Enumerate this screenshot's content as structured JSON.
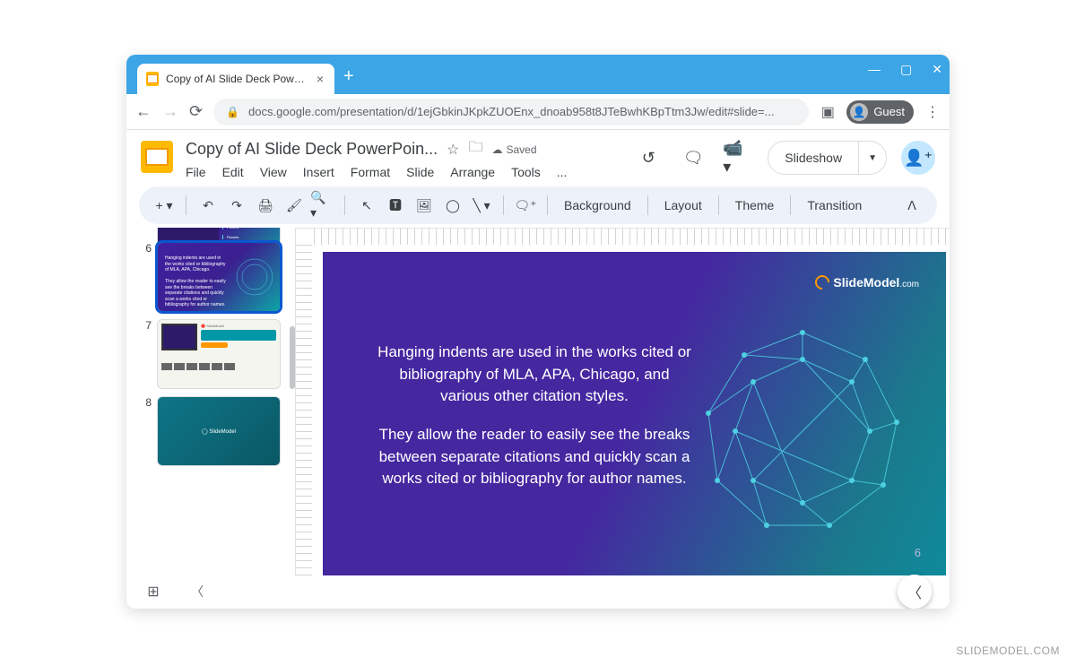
{
  "browser": {
    "tab_title": "Copy of AI Slide Deck PowerPoin",
    "url": "docs.google.com/presentation/d/1ejGbkinJKpkZUOEnx_dnoab958t8JTeBwhKBpTtm3Jw/edit#slide=...",
    "guest_label": "Guest"
  },
  "doc": {
    "title": "Copy of AI Slide Deck PowerPoin...",
    "saved": "Saved"
  },
  "menu": {
    "file": "File",
    "edit": "Edit",
    "view": "View",
    "insert": "Insert",
    "format": "Format",
    "slide": "Slide",
    "arrange": "Arrange",
    "tools": "Tools",
    "more": "..."
  },
  "header_btns": {
    "slideshow": "Slideshow"
  },
  "toolbar": {
    "background": "Background",
    "layout": "Layout",
    "theme": "Theme",
    "transition": "Transition"
  },
  "filmstrip": {
    "n6": "6",
    "n7": "7",
    "n8": "8"
  },
  "slide": {
    "logo_text": "SlideModel",
    "logo_suffix": ".com",
    "p1": "Hanging indents are used in the works cited or bibliography of MLA, APA, Chicago, and various other citation styles.",
    "p2": "They allow the reader to easily see the breaks between separate citations and quickly scan a works cited or bibliography for author names.",
    "page_num": "6"
  },
  "watermark": "SLIDEMODEL.COM"
}
